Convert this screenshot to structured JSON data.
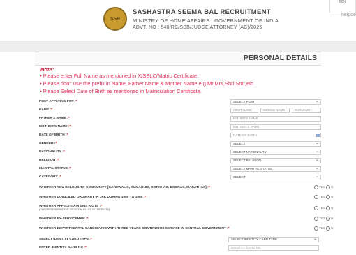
{
  "header": {
    "logo_text": "SSB",
    "org": "SASHASTRA SEEMA BAL RECRUITMENT",
    "ministry": "MINISTRY OF HOME AFFAIRS | GOVERNMENT OF INDIA",
    "advt": "ADVT. NO : 540/RC/SSB/JUDGE ATTORNEY (AC)/2026",
    "zoom": "80%",
    "help": "helpde"
  },
  "section_title": "PERSONAL DETAILS",
  "notes": {
    "title": "Note:",
    "items": [
      "Please enter Full Name as mentioned in X/SSLC/Matric Certificate.",
      "Please don't use the prefix in Name, Father Name & Mother Name e.g.Mr,Mrs,Shri,Smt,etc.",
      "Please Select Date of Birth as mentioned in Matriculation Certificate."
    ]
  },
  "form": {
    "post": {
      "label": "POST APPLYING FOR :",
      "value": "SELECT POST"
    },
    "name": {
      "label": "NAME :",
      "first": "FIRST NAME",
      "middle": "MIDDLE NAME",
      "surname": "SURNAME"
    },
    "father": {
      "label": "FATHER'S NAME :",
      "placeholder": "FATHER'S NAME"
    },
    "mother": {
      "label": "MOTHER'S NAME :",
      "placeholder": "MOTHER'S NAME"
    },
    "dob": {
      "label": "DATE OF BIRTH :",
      "placeholder": "DATE OF BIRTH"
    },
    "gender": {
      "label": "GENDER :",
      "value": "SELECT"
    },
    "nationality": {
      "label": "NATIONALITY :",
      "value": "SELECT NATIONALITY"
    },
    "religion": {
      "label": "RELIGION :",
      "value": "SELECT RELIGION"
    },
    "marital": {
      "label": "MARITAL STATUS :",
      "value": "SELECT MARITAL STATUS"
    },
    "category": {
      "label": "CATEGORY :",
      "value": "SELECT"
    },
    "community": {
      "label": "WHETHER YOU BELONG TO COMMUNITY [GARHWALIS, KUMAONIS, GORKHAS, DOGRAS, MARATHAS] :"
    },
    "domiciled": {
      "label": "WHETHER DOMICILED ORDINARY IN J&K DURING 1980 TO 1989 :"
    },
    "riots": {
      "label": "WHETHER AFFECTED IN 1984 RIOTS :",
      "sub": "(CHILDREN/DEPENDENT OF VICTIM KILLED IN THE RIOTS)"
    },
    "exservice": {
      "label": "WHETHER EX-SERVICEMAN :"
    },
    "departmental": {
      "label": "WHETHER DEPARTMENTAL CANDIDATES WITH THREE YEARS CONTINUOUS SERVICE IN CENTRAL GOVERNMENT :"
    },
    "id_type": {
      "label": "SELECT IDENTITY CARD TYPE :",
      "value": "SELECT IDENTITY CARD TYPE"
    },
    "id_no": {
      "label": "ENTER IDENTITY CARD NO :",
      "placeholder": "IDENTITY CARD NO"
    },
    "yes": "YES",
    "no": "N"
  }
}
